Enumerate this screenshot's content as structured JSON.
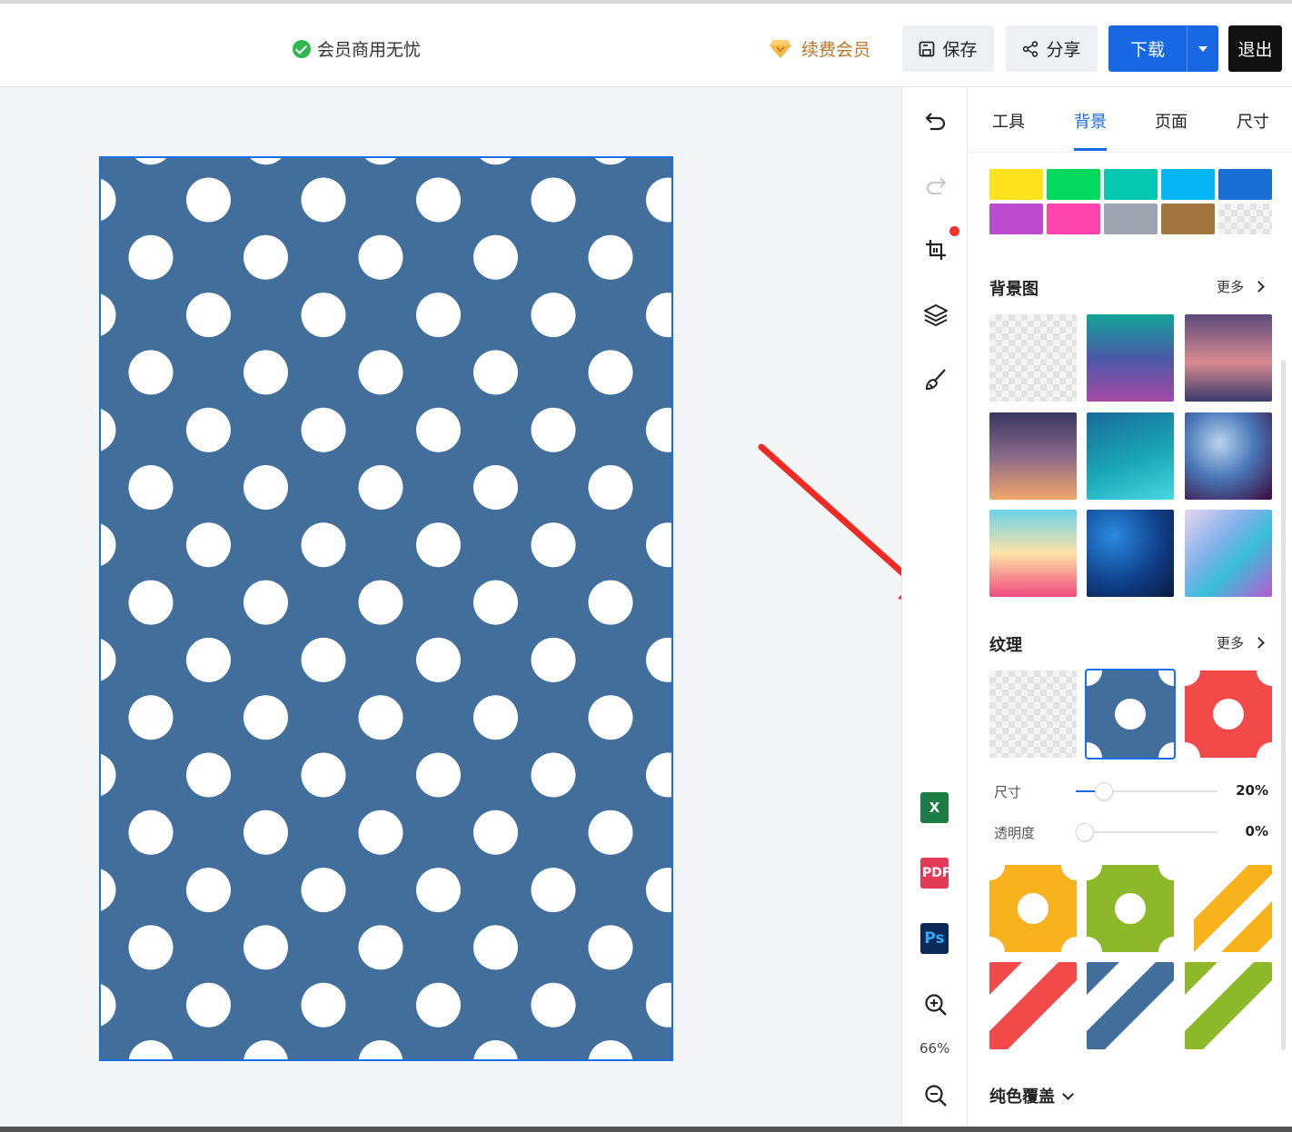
{
  "header": {
    "vip_status": "会员商用无忧",
    "renew": "续费会员",
    "save": "保存",
    "share": "分享",
    "download": "下载",
    "exit": "退出"
  },
  "canvas": {
    "pattern": "polka-dot",
    "background": "#426e9c",
    "dot_color": "#ffffff"
  },
  "vtoolbar": {
    "icons": [
      "undo-icon",
      "redo-icon",
      "crop-icon",
      "layers-icon",
      "brush-icon"
    ],
    "exports": {
      "excel": "X",
      "pdf": "PDF",
      "ps": "Ps"
    },
    "zoom": "66%"
  },
  "panel": {
    "tabs": [
      "工具",
      "背景",
      "页面",
      "尺寸"
    ],
    "active_tab": "背景",
    "colors": [
      "#fde21c",
      "#05d960",
      "#06c7b2",
      "#06b6f4",
      "#1a6fd4",
      "#bb4ccf",
      "#fd44ad",
      "#9da3b1",
      "#a37641",
      "transparent"
    ],
    "bg_image": {
      "title": "背景图",
      "more": "更多"
    },
    "texture": {
      "title": "纹理",
      "more": "更多",
      "size_label": "尺寸",
      "size_value": "20%",
      "size_level": 0.2,
      "opacity_label": "透明度",
      "opacity_value": "0%",
      "opacity_level": 0
    },
    "cover": "纯色覆盖"
  }
}
